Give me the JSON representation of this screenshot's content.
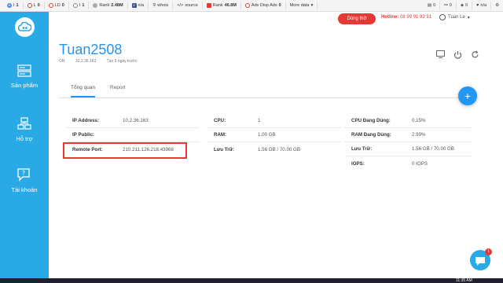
{
  "seobar": {
    "items": [
      {
        "icon": "google-icon",
        "label": "I",
        "value": "1",
        "color": "#4285f4"
      },
      {
        "icon": "l-icon",
        "label": "L",
        "value": "0",
        "color": "#e53935"
      },
      {
        "icon": "ld-icon",
        "label": "LD",
        "value": "0",
        "color": "#e53935"
      },
      {
        "icon": "i-icon",
        "label": "I",
        "value": "1",
        "color": "#888888"
      },
      {
        "icon": "rank-icon",
        "label": "Rank",
        "value": "2.48M",
        "color": "#777777"
      },
      {
        "icon": "facebook-icon",
        "label": "n/a",
        "value": "",
        "color": "#3b5998"
      },
      {
        "icon": "whois-icon",
        "label": "whois",
        "value": "",
        "color": "#777777"
      },
      {
        "icon": "source-icon",
        "label": "source",
        "value": "",
        "color": "#777777"
      },
      {
        "icon": "rank2-icon",
        "label": "Rank",
        "value": "46.8M",
        "color": "#e53935"
      },
      {
        "icon": "adv-icon",
        "label": "Adv Disp Ads",
        "value": "0",
        "color": "#e53935"
      },
      {
        "icon": "more-icon",
        "label": "More data",
        "value": "",
        "color": "#777777"
      }
    ],
    "right_items": [
      {
        "icon": "doc-icon",
        "value": "0"
      },
      {
        "icon": "link-icon",
        "value": "0"
      },
      {
        "icon": "share-icon",
        "value": "0"
      },
      {
        "icon": "heart-icon",
        "value": "n/a"
      }
    ]
  },
  "sidebar": {
    "items": [
      {
        "label": "Sản phẩm"
      },
      {
        "label": "Hỗ trợ"
      },
      {
        "label": "Tài khoản"
      }
    ]
  },
  "header": {
    "trial_label": "Dùng thử",
    "hotline_label": "Hotline:",
    "hotline_number": "08 99 91 93 91",
    "user_name": "Tuan Le"
  },
  "server": {
    "name": "Tuan2508",
    "status": "ON",
    "ip": "10.2.36.163",
    "created": "Tạo 5 ngày trước"
  },
  "tabs": [
    {
      "label": "Tổng quan",
      "active": true
    },
    {
      "label": "Report",
      "active": false
    }
  ],
  "details": {
    "col1": [
      {
        "label": "IP Address:",
        "value": "10.2.36.163"
      },
      {
        "label": "IP Public:",
        "value": ""
      },
      {
        "label": "Remote Port:",
        "value": "210.211.126.218:43968"
      }
    ],
    "col2": [
      {
        "label": "CPU:",
        "value": "1"
      },
      {
        "label": "RAM:",
        "value": "1.00 GB"
      },
      {
        "label": "Lưu Trữ:",
        "value": "1.56 GB / 70.00 GB"
      }
    ],
    "col3": [
      {
        "label": "CPU Đang Dùng:",
        "value": "0.15%"
      },
      {
        "label": "RAM Đang Dùng:",
        "value": "2.99%"
      },
      {
        "label": "Lưu Trữ:",
        "value": "1.56 GB / 70.00 GB"
      },
      {
        "label": "IOPS:",
        "value": "0 IOPS"
      }
    ]
  },
  "chat": {
    "badge": "1"
  },
  "taskbar": {
    "time": "11:35 AM"
  }
}
